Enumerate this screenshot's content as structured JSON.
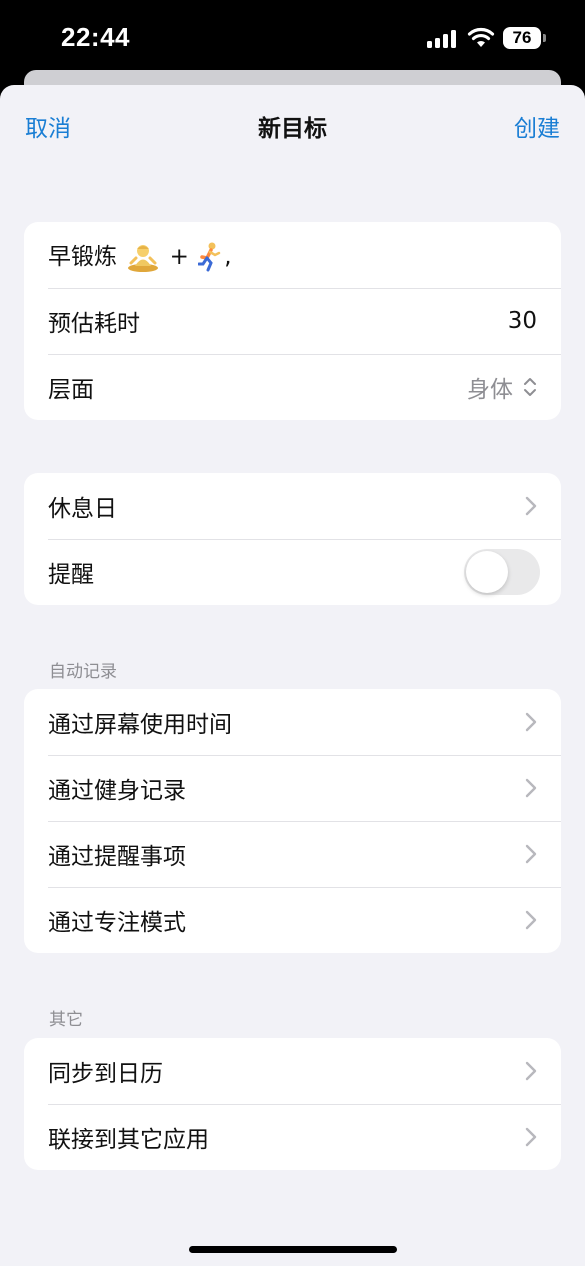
{
  "status_bar": {
    "time": "22:44",
    "battery": "76"
  },
  "nav": {
    "cancel": "取消",
    "title": "新目标",
    "create": "创建"
  },
  "goal": {
    "name_text": "早锻炼",
    "name_plus": "+",
    "name_suffix": ",",
    "duration_label": "预估耗时",
    "duration_value": "30",
    "level_label": "层面",
    "level_value": "身体"
  },
  "schedule": {
    "rest_day_label": "休息日",
    "reminder_label": "提醒",
    "reminder_on": false
  },
  "auto_record": {
    "header": "自动记录",
    "items": [
      "通过屏幕使用时间",
      "通过健身记录",
      "通过提醒事项",
      "通过专注模式"
    ]
  },
  "other": {
    "header": "其它",
    "items": [
      "同步到日历",
      "联接到其它应用"
    ]
  },
  "colors": {
    "accent": "#1a7ed4",
    "background": "#f2f2f7",
    "secondary_text": "#8e8e93"
  }
}
